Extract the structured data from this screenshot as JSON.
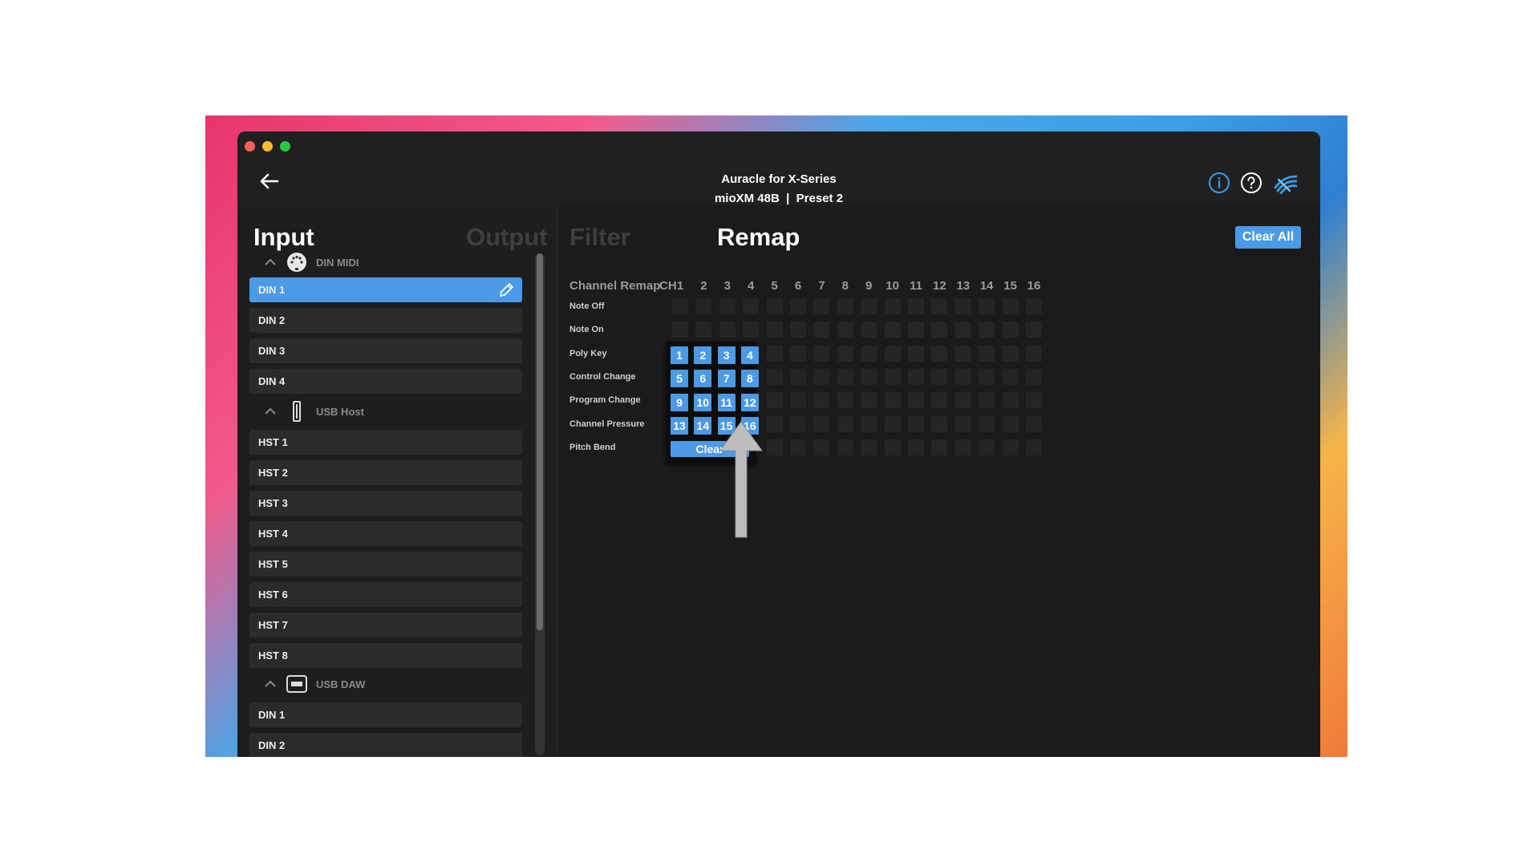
{
  "window": {
    "title_line1": "Auracle for X-Series",
    "title_line2": "mioXM 48B  |  Preset 2"
  },
  "icons": {
    "back": "arrow-left-icon",
    "info": "info-icon",
    "help": "help-icon",
    "logo": "brand-logo-icon"
  },
  "colors": {
    "accent": "#4b9ae8",
    "background": "#1b1b1b",
    "panel": "#1e1e1e",
    "row": "#2b2b2b"
  },
  "left": {
    "tabs": {
      "input": "Input",
      "output": "Output"
    },
    "groups": [
      {
        "label": "DIN MIDI",
        "ports": [
          "DIN 1",
          "DIN 2",
          "DIN 3",
          "DIN 4"
        ]
      },
      {
        "label": "USB Host",
        "ports": [
          "HST 1",
          "HST 2",
          "HST 3",
          "HST 4",
          "HST 5",
          "HST 6",
          "HST 7",
          "HST 8"
        ]
      },
      {
        "label": "USB DAW",
        "ports": [
          "DIN 1",
          "DIN 2"
        ]
      }
    ],
    "selected_port": "DIN 1"
  },
  "right": {
    "tabs": {
      "filter": "Filter",
      "remap": "Remap"
    },
    "clear_all": "Clear All",
    "matrix_title": "Channel Remap",
    "ch_label": "CH",
    "channels": [
      "1",
      "2",
      "3",
      "4",
      "5",
      "6",
      "7",
      "8",
      "9",
      "10",
      "11",
      "12",
      "13",
      "14",
      "15",
      "16"
    ],
    "rows": [
      "Note Off",
      "Note On",
      "Poly Key",
      "Control Change",
      "Program Change",
      "Channel Pressure",
      "Pitch Bend"
    ]
  },
  "popup": {
    "channels": [
      "1",
      "2",
      "3",
      "4",
      "5",
      "6",
      "7",
      "8",
      "9",
      "10",
      "11",
      "12",
      "13",
      "14",
      "15",
      "16"
    ],
    "clear": "Clear"
  }
}
